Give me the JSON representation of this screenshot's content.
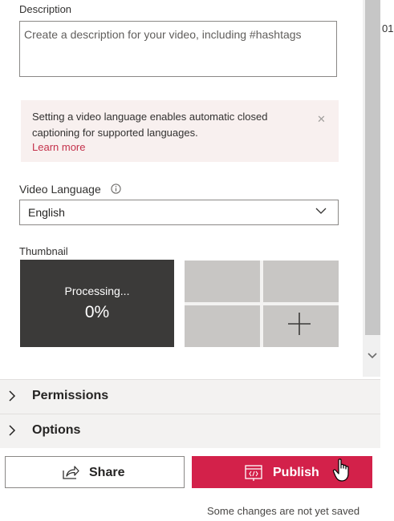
{
  "description": {
    "label": "Description",
    "placeholder": "Create a description for your video, including #hashtags"
  },
  "notice": {
    "text": "Setting a video language enables automatic closed captioning for supported languages.",
    "link": "Learn more",
    "close_icon": "close-icon"
  },
  "video_language": {
    "label": "Video Language",
    "info_icon": "info-icon",
    "selected": "English"
  },
  "thumbnail": {
    "label": "Thumbnail",
    "processing_text": "Processing...",
    "progress": "0%",
    "add_icon": "plus-icon"
  },
  "sections": [
    {
      "label": "Permissions",
      "icon": "chevron-right-icon"
    },
    {
      "label": "Options",
      "icon": "chevron-right-icon"
    }
  ],
  "actions": {
    "share_label": "Share",
    "share_icon": "share-icon",
    "publish_label": "Publish",
    "publish_icon": "publish-icon"
  },
  "footer": {
    "status": "Some changes are not yet saved"
  },
  "edge_text": "01",
  "colors": {
    "accent": "#d3214a",
    "link": "#c4314b",
    "processing_bg": "#3b3a39"
  }
}
